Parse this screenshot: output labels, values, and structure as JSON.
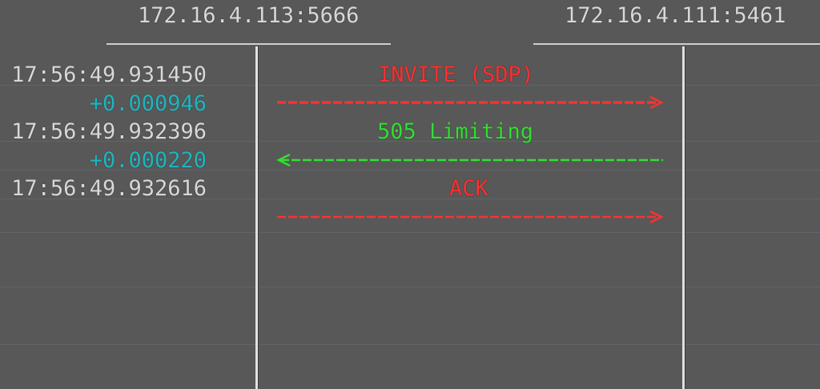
{
  "colors": {
    "background": "#585858",
    "text": "#d8d8d8",
    "delta": "#1fb5c0",
    "request": "#ff3030",
    "response": "#30e030"
  },
  "endpoints": {
    "left": "172.16.4.113:5666",
    "right": "172.16.4.111:5461"
  },
  "rows": [
    {
      "time": "17:56:49.931450",
      "delta": "+0.000946",
      "label": "INVITE (SDP)",
      "direction": "right",
      "kind": "request"
    },
    {
      "time": "17:56:49.932396",
      "delta": "+0.000220",
      "label": "505 Limiting",
      "direction": "left",
      "kind": "response"
    },
    {
      "time": "17:56:49.932616",
      "delta": "",
      "label": "ACK",
      "direction": "right",
      "kind": "request"
    }
  ]
}
